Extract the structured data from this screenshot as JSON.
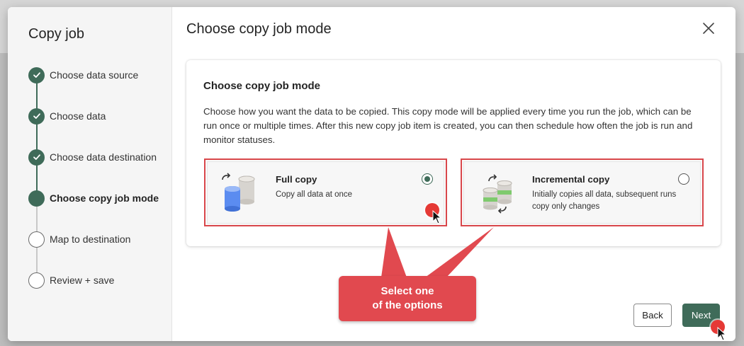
{
  "sidebar": {
    "title": "Copy job",
    "steps": [
      {
        "label": "Choose data source",
        "state": "done"
      },
      {
        "label": "Choose data",
        "state": "done"
      },
      {
        "label": "Choose data destination",
        "state": "done"
      },
      {
        "label": "Choose copy job mode",
        "state": "current"
      },
      {
        "label": "Map to destination",
        "state": "pending"
      },
      {
        "label": "Review + save",
        "state": "pending"
      }
    ]
  },
  "main": {
    "title": "Choose copy job mode",
    "card": {
      "heading": "Choose copy job mode",
      "description": "Choose how you want the data to be copied. This copy mode will be applied every time you run the job, which can be run once or multiple times. After this new copy job item is created, you can then schedule how often the job is run and monitor statuses.",
      "options": [
        {
          "title": "Full copy",
          "description": "Copy all data at once",
          "selected": true,
          "icon": "database-full-copy-icon"
        },
        {
          "title": "Incremental copy",
          "description": "Initially copies all data, subsequent runs copy only changes",
          "selected": false,
          "icon": "database-incremental-copy-icon"
        }
      ]
    }
  },
  "callout": {
    "line1": "Select one",
    "line2": "of the options"
  },
  "footer": {
    "back_label": "Back",
    "next_label": "Next"
  },
  "colors": {
    "accent": "#3f6b59",
    "highlight": "#d9474b",
    "callout": "#e1494f"
  }
}
